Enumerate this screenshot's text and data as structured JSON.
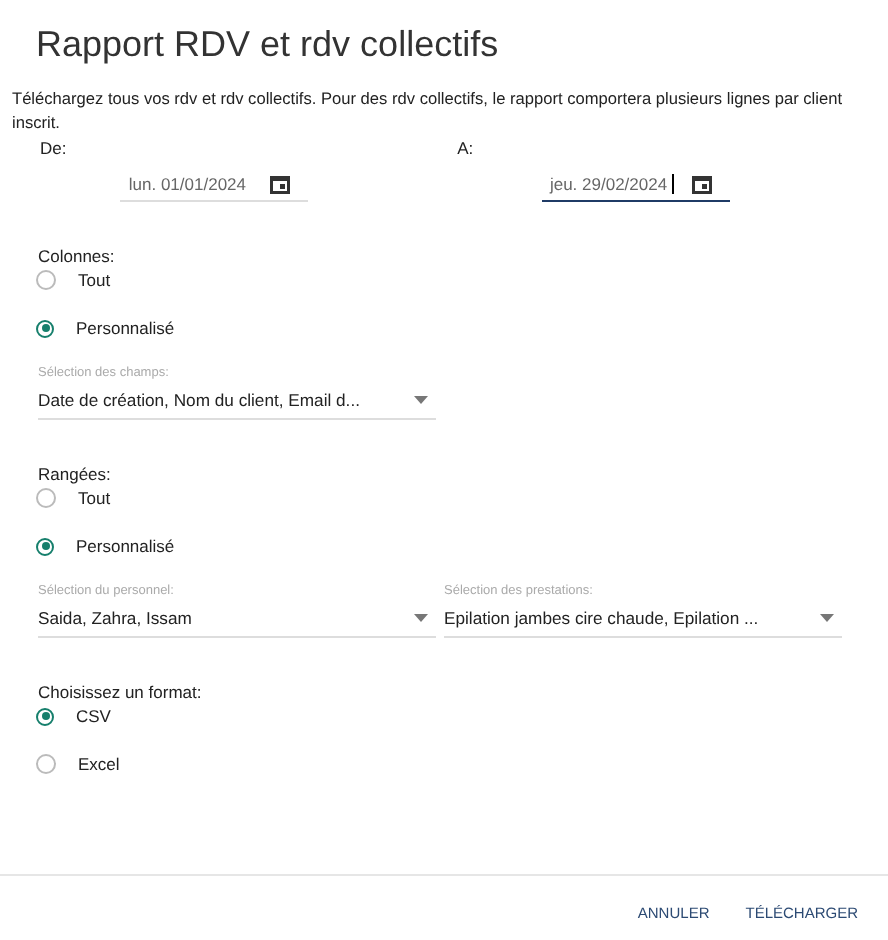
{
  "title": "Rapport RDV et rdv collectifs",
  "description": "Téléchargez tous vos rdv et rdv collectifs. Pour des rdv collectifs, le rapport comportera plusieurs lignes par client inscrit.",
  "date_range": [
    {
      "label": "De:",
      "value": "lun. 01/01/2024",
      "focused": false
    },
    {
      "label": "A:",
      "value": "jeu. 29/02/2024",
      "focused": true
    }
  ],
  "columns": {
    "label": "Colonnes:",
    "options": [
      {
        "label": "Tout",
        "selected": false
      },
      {
        "label": "Personnalisé",
        "selected": true
      }
    ],
    "selects": [
      {
        "label": "Sélection des champs:",
        "value": "Date de création, Nom du client, Email d..."
      }
    ]
  },
  "rows": {
    "label": "Rangées:",
    "options": [
      {
        "label": "Tout",
        "selected": false
      },
      {
        "label": "Personnalisé",
        "selected": true
      }
    ],
    "selects": [
      {
        "label": "Sélection du personnel:",
        "value": "Saida, Zahra, Issam"
      },
      {
        "label": "Sélection des prestations:",
        "value": "Epilation jambes cire chaude, Epilation ..."
      }
    ]
  },
  "format": {
    "label": "Choisissez un format:",
    "options": [
      {
        "label": "CSV",
        "selected": true
      },
      {
        "label": "Excel",
        "selected": false
      }
    ]
  },
  "buttons": [
    "ANNULER",
    "TÉLÉCHARGER"
  ]
}
